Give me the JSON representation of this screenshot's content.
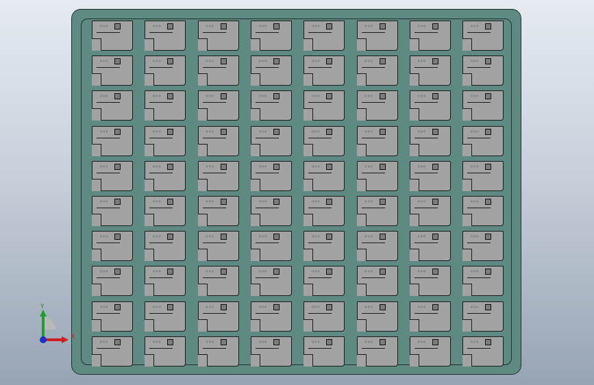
{
  "viewport": {
    "background_top": "#e6ebf1",
    "background_bottom": "#97a4b3"
  },
  "tray": {
    "color": "#5e8a82",
    "pocket_color": "#a3a3a3",
    "rows": 10,
    "columns": 8,
    "pocket_symbol": "◦◦◦"
  },
  "triad": {
    "x_label": "X",
    "y_label": "Y",
    "x_color": "#cc1f1f",
    "y_color": "#1f9e2c",
    "z_color": "#1f2fcc"
  }
}
